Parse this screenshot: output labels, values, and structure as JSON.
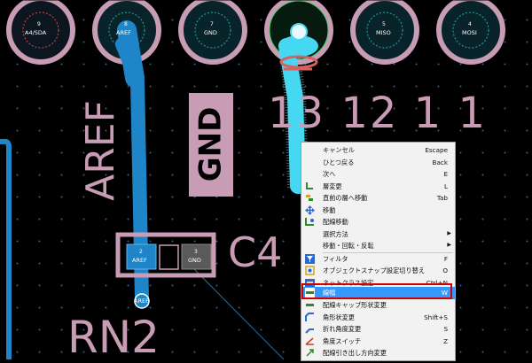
{
  "pads": [
    {
      "num": "9",
      "name": "A4/SDA"
    },
    {
      "num": "8",
      "name": "AREF"
    },
    {
      "num": "7",
      "name": "GND"
    },
    {
      "num": "",
      "name": ""
    },
    {
      "num": "5",
      "name": "MISO"
    },
    {
      "num": "4",
      "name": "MOSI"
    }
  ],
  "silk": {
    "pin_numbers": "13 12 1 1",
    "aref_vertical": "AREF",
    "gnd_vertical": "GND",
    "c4": "C4",
    "rn2": "RN2"
  },
  "component": {
    "pad2_num": "2",
    "pad2_net": "AREF",
    "pad3_num": "3",
    "pad3_net": "GND",
    "via_label": "AREF"
  },
  "context_menu": {
    "items": [
      {
        "label": "キャンセル",
        "shortcut": "Escape",
        "icon": "none"
      },
      {
        "label": "ひとつ戻る",
        "shortcut": "Back",
        "icon": "none"
      },
      {
        "label": "次へ",
        "shortcut": "E",
        "icon": "none"
      },
      {
        "label": "層変更",
        "shortcut": "L",
        "icon": "layer-change-icon"
      },
      {
        "label": "直前の層へ移動",
        "shortcut": "Tab",
        "icon": "prev-layer-icon"
      },
      {
        "label": "移動",
        "shortcut": "",
        "icon": "move-icon"
      },
      {
        "label": "配線移動",
        "shortcut": "",
        "icon": "move-track-icon"
      },
      {
        "label": "選択方法",
        "shortcut": "",
        "icon": "none",
        "submenu": true
      },
      {
        "label": "移動・回転・反転",
        "shortcut": "",
        "icon": "none",
        "submenu": true
      },
      {
        "label": "フィルタ",
        "shortcut": "F",
        "icon": "filter-icon"
      },
      {
        "label": "オブジェクトスナップ設定切り替え",
        "shortcut": "O",
        "icon": "snap-icon"
      },
      {
        "label": "ネットクラス設定",
        "shortcut": "Ctrl+N",
        "icon": "netclass-icon"
      },
      {
        "label": "線幅",
        "shortcut": "W",
        "icon": "width-icon",
        "highlighted": true
      },
      {
        "label": "配線キャップ形状変更",
        "shortcut": "",
        "icon": "cap-icon"
      },
      {
        "label": "角形状変更",
        "shortcut": "Shift+S",
        "icon": "corner-icon"
      },
      {
        "label": "折れ角度変更",
        "shortcut": "S",
        "icon": "bend-icon"
      },
      {
        "label": "角度スイッチ",
        "shortcut": "Z",
        "icon": "angle-icon"
      },
      {
        "label": "配線引き出し方向変更",
        "shortcut": "",
        "icon": "direction-icon"
      }
    ],
    "partial_last_shortcut": "X"
  },
  "colors": {
    "silk": "#c89cb4",
    "track_blue": "#1e86c8",
    "track_cyan": "#45d8f0",
    "highlight": "#3399ff",
    "red_box": "#d10000"
  }
}
